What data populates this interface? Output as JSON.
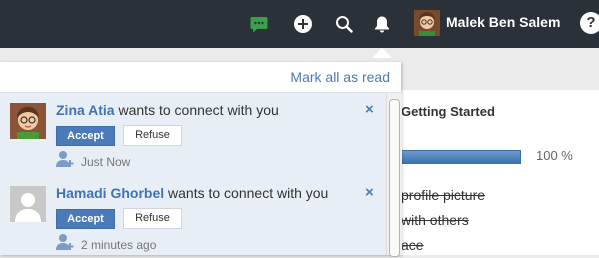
{
  "topbar": {
    "username": "Malek Ben Salem",
    "help_label": "?",
    "icons": [
      "chat-icon",
      "plus-circle-icon",
      "search-icon",
      "bell-icon"
    ],
    "colors": {
      "bar": "#2b3138",
      "chat": "#3aa14a"
    }
  },
  "notifications": {
    "mark_all_label": "Mark all as read",
    "items": [
      {
        "name": "Zina Atia",
        "message": "wants to connect with you",
        "accept": "Accept",
        "refuse": "Refuse",
        "time": "Just Now",
        "close": "×"
      },
      {
        "name": "Hamadi Ghorbel",
        "message": "wants to connect with you",
        "accept": "Accept",
        "refuse": "Refuse",
        "time": "2 minutes ago",
        "close": "×"
      }
    ]
  },
  "getting_started": {
    "title": "Getting Started",
    "progress_percent": 100,
    "progress_label": "100 %",
    "tasks": [
      "profile picture",
      "with others",
      "ace"
    ]
  }
}
